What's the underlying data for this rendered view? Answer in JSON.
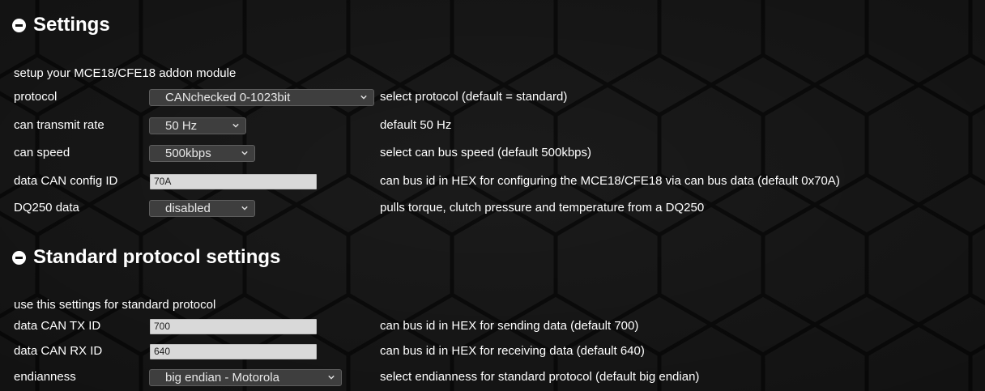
{
  "settings": {
    "title": "Settings",
    "description": "setup your MCE18/CFE18 addon module",
    "rows": [
      {
        "label": "protocol",
        "value": "CANchecked 0-1023bit",
        "help": "select protocol (default = standard)"
      },
      {
        "label": "can transmit rate",
        "value": "50 Hz",
        "help": "default 50 Hz"
      },
      {
        "label": "can speed",
        "value": "500kbps",
        "help": "select can bus speed (default 500kbps)"
      },
      {
        "label": "data CAN config ID",
        "value": "70A",
        "help": "can bus id in HEX for configuring the MCE18/CFE18 via can bus data (default 0x70A)"
      },
      {
        "label": "DQ250 data",
        "value": "disabled",
        "help": "pulls torque, clutch pressure and temperature from a DQ250"
      }
    ]
  },
  "standard": {
    "title": "Standard protocol settings",
    "description": "use this settings for standard protocol",
    "rows": [
      {
        "label": "data CAN TX ID",
        "value": "700",
        "help": "can bus id in HEX for sending data (default 700)"
      },
      {
        "label": "data CAN RX ID",
        "value": "640",
        "help": "can bus id in HEX for receiving data (default 640)"
      },
      {
        "label": "endianness",
        "value": "big endian - Motorola",
        "help": "select endianness for standard protocol (default big endian)"
      }
    ]
  },
  "icons": {
    "collapse": "minus-circle-icon",
    "dropdown": "chevron-down-icon"
  },
  "colors": {
    "background": "#121212",
    "hexagon": "#1c1c1c",
    "text": "#ffffff",
    "select_bg": "#3e3e3e",
    "input_bg": "#d9d9d9"
  }
}
